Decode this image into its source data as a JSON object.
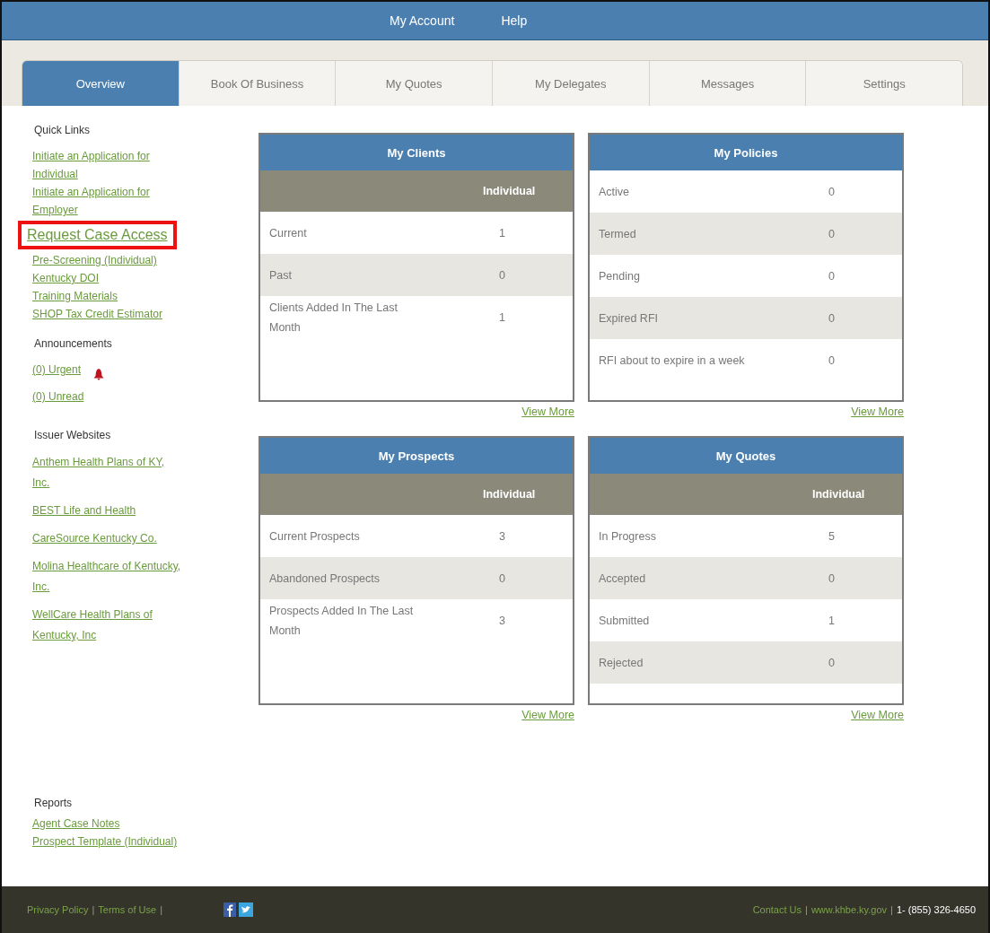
{
  "top_nav": [
    "My Account",
    "Help"
  ],
  "tabs": [
    {
      "label": "Overview",
      "selected": true
    },
    {
      "label": "Book Of Business",
      "selected": false
    },
    {
      "label": "My Quotes",
      "selected": false
    },
    {
      "label": "My Delegates",
      "selected": false
    },
    {
      "label": "Messages",
      "selected": false
    },
    {
      "label": "Settings",
      "selected": false
    }
  ],
  "sidebar": {
    "sections": [
      {
        "heading": "Quick Links",
        "links": [
          {
            "label": "Initiate an Application for Individual",
            "highlighted": false
          },
          {
            "label": "Initiate an Application for Employer",
            "highlighted": false
          },
          {
            "label": "Request Case Access",
            "highlighted": true
          },
          {
            "label": "Pre-Screening (Individual)",
            "highlighted": false
          },
          {
            "label": "Kentucky DOI",
            "highlighted": false
          },
          {
            "label": "Training Materials",
            "highlighted": false
          },
          {
            "label": "SHOP Tax Credit Estimator",
            "highlighted": false
          }
        ]
      },
      {
        "heading": "Announcements",
        "links": [
          {
            "label": "(0) Urgent",
            "highlighted": false,
            "alert": true
          },
          {
            "label": "(0) Unread",
            "highlighted": false,
            "alert": false
          }
        ]
      },
      {
        "heading": "Issuer Websites",
        "links": [
          {
            "label": "Anthem Health Plans of KY, Inc.",
            "highlighted": false
          },
          {
            "label": "BEST Life and Health",
            "highlighted": false
          },
          {
            "label": "CareSource Kentucky Co.",
            "highlighted": false
          },
          {
            "label": "Molina Healthcare of Kentucky, Inc.",
            "highlighted": false
          },
          {
            "label": "WellCare Health Plans of Kentucky, Inc",
            "highlighted": false
          }
        ]
      }
    ],
    "reports": {
      "heading": "Reports",
      "links": [
        {
          "label": "Agent Case Notes",
          "highlighted": false
        },
        {
          "label": "Prospect Template (Individual)",
          "highlighted": false
        }
      ]
    }
  },
  "cards": [
    {
      "title": "My Clients",
      "column": "Individual",
      "rows": [
        {
          "label": "Current",
          "value": "1"
        },
        {
          "label": "Past",
          "value": "0"
        },
        {
          "label": "Clients Added In The Last Month",
          "value": "1"
        }
      ],
      "link": "View More"
    },
    {
      "title": "My Policies",
      "rows": [
        {
          "label": "Active",
          "value": "0"
        },
        {
          "label": "Termed",
          "value": "0"
        },
        {
          "label": "Pending",
          "value": "0"
        },
        {
          "label": "Expired RFI",
          "value": "0"
        },
        {
          "label": "RFI about to expire in a week",
          "value": "0"
        }
      ],
      "link": "View More"
    },
    {
      "title": "My Prospects",
      "column": "Individual",
      "rows": [
        {
          "label": "Current Prospects",
          "value": "3"
        },
        {
          "label": "Abandoned Prospects",
          "value": "0"
        },
        {
          "label": "Prospects Added In The Last Month",
          "value": "3"
        }
      ],
      "link": "View More"
    },
    {
      "title": "My Quotes",
      "column": "Individual",
      "rows": [
        {
          "label": "In Progress",
          "value": "5"
        },
        {
          "label": "Accepted",
          "value": "0"
        },
        {
          "label": "Submitted",
          "value": "1"
        },
        {
          "label": "Rejected",
          "value": "0"
        }
      ],
      "link": "View More"
    }
  ],
  "footer": {
    "left": [
      {
        "kind": "link",
        "text": "Privacy Policy"
      },
      {
        "kind": "separator",
        "text": "|"
      },
      {
        "kind": "link",
        "text": "Terms of Use"
      },
      {
        "kind": "separator",
        "text": "|"
      }
    ],
    "right": [
      {
        "kind": "link",
        "text": "Contact Us"
      },
      {
        "kind": "separator",
        "text": "|"
      },
      {
        "kind": "link",
        "text": "www.khbe.ky.gov"
      },
      {
        "kind": "separator",
        "text": "|"
      },
      {
        "kind": "text",
        "text": "1- (855) 326-4650"
      }
    ]
  }
}
